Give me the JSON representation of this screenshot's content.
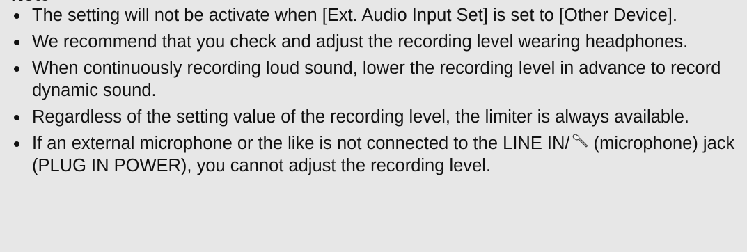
{
  "heading": "Note",
  "notes": [
    {
      "text": "The setting will not be activate when [Ext. Audio Input Set] is set to [Other Device]."
    },
    {
      "text": "We recommend that you check and adjust the recording level wearing headphones."
    },
    {
      "text": "When continuously recording loud sound, lower the recording level in advance to record dynamic sound."
    },
    {
      "text": "Regardless of the setting value of the recording level, the limiter is always available."
    },
    {
      "text_before": "If an external microphone or the like is not connected to the LINE IN/",
      "icon": "microphone-icon",
      "text_after": " (microphone) jack (PLUG IN POWER), you cannot adjust the recording level."
    }
  ],
  "colors": {
    "background": "#e7e7e7",
    "text": "#111111"
  }
}
